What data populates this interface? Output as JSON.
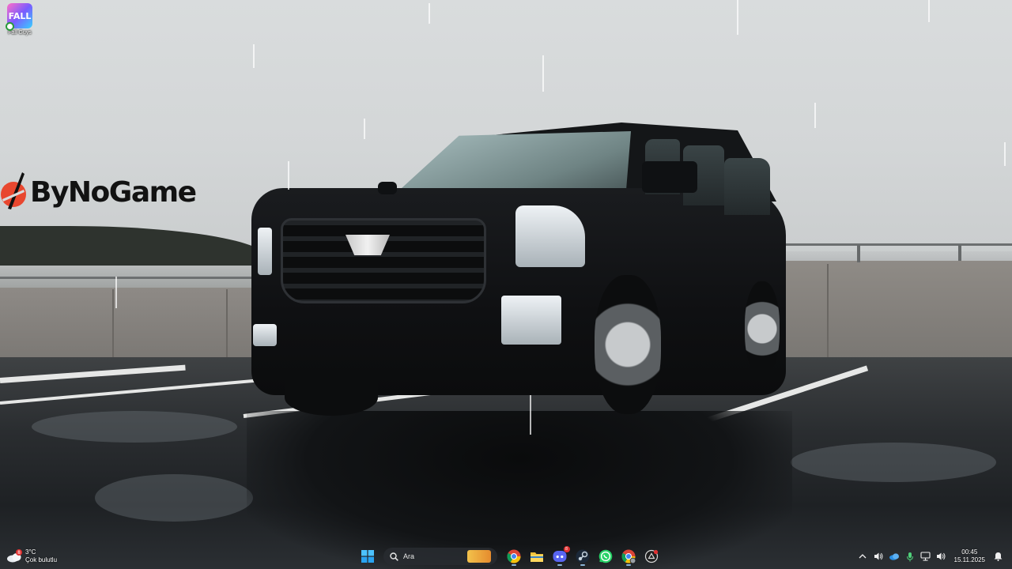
{
  "desktop": {
    "icons": [
      {
        "label": "Fall Guys",
        "icon": "fall-guys-icon",
        "art_text": "FALL"
      }
    ]
  },
  "logo": {
    "text": "ByNoGame",
    "mark_color": "#e8472f"
  },
  "taskbar": {
    "weather": {
      "temperature": "3°C",
      "condition": "Çok bulutlu",
      "icon": "cloudy-weather-icon",
      "badge": "8"
    },
    "start_icon": "windows-start-icon",
    "search": {
      "placeholder": "Ara",
      "icon": "search-icon"
    },
    "pinned_apps": [
      {
        "name": "Google Chrome",
        "icon": "chrome-icon",
        "active": true
      },
      {
        "name": "File Explorer",
        "icon": "folder-icon",
        "active": false
      },
      {
        "name": "Discord",
        "icon": "discord-icon",
        "active": true,
        "badge": "8"
      },
      {
        "name": "Steam",
        "icon": "steam-icon",
        "active": true
      },
      {
        "name": "WhatsApp",
        "icon": "whatsapp-icon",
        "active": false
      },
      {
        "name": "Google Chrome Profile",
        "icon": "chrome-profile-icon",
        "active": true
      },
      {
        "name": "App",
        "icon": "app-icon",
        "active": false
      }
    ],
    "tray": {
      "items": [
        {
          "name": "show-hidden-icons",
          "icon": "chevron-up-icon",
          "glyph": "^"
        },
        {
          "name": "volume-mixer",
          "icon": "speaker-icon",
          "glyph": "🔊"
        },
        {
          "name": "onedrive",
          "icon": "cloud-icon",
          "glyph": "☁"
        },
        {
          "name": "microphone",
          "icon": "microphone-icon",
          "glyph": "🎤"
        },
        {
          "name": "network",
          "icon": "network-icon",
          "glyph": "🖧"
        },
        {
          "name": "volume",
          "icon": "volume-icon",
          "glyph": "🔊"
        }
      ],
      "time": "00:45",
      "date": "15.11.2025",
      "notification_icon": "notification-bell-icon"
    }
  },
  "colors": {
    "accent": "#8ab4d8",
    "search_bg": "#282c30",
    "taskbar_text": "#ffffff"
  }
}
